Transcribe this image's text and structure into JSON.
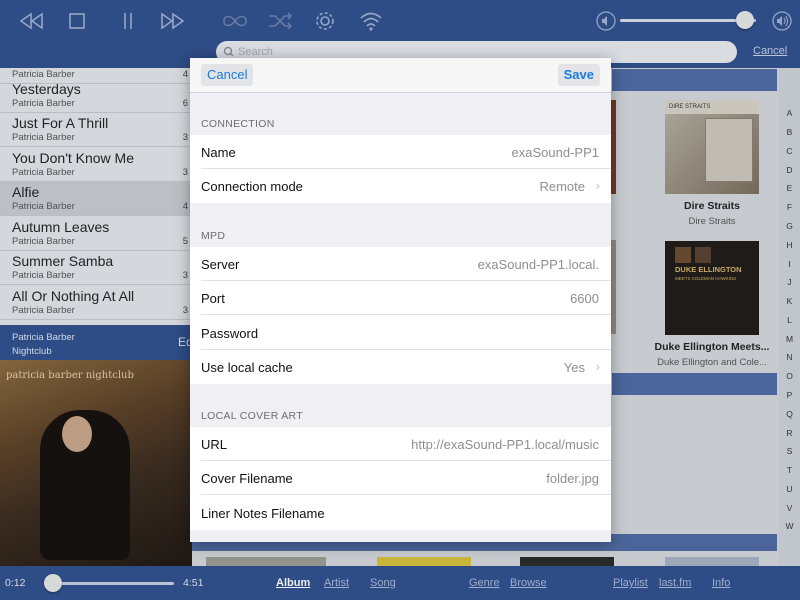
{
  "topbar": {
    "icons": [
      "rewind-icon",
      "stop-icon",
      "pause-icon",
      "fast-forward-icon",
      "repeat-icon",
      "shuffle-icon",
      "gear-icon",
      "wifi-icon",
      "volume-low-icon",
      "volume-high-icon"
    ],
    "volume_level": 0.92,
    "search_placeholder": "Search",
    "search_cancel": "Cancel"
  },
  "songlist": {
    "partial_top_artist": "Patricia Barber",
    "partial_top_number": "4",
    "songs": [
      {
        "title": "Yesterdays",
        "artist": "Patricia Barber",
        "num": "6"
      },
      {
        "title": "Just For A Thrill",
        "artist": "Patricia Barber",
        "num": "3"
      },
      {
        "title": "You Don't Know Me",
        "artist": "Patricia Barber",
        "num": "3"
      },
      {
        "title": "Alfie",
        "artist": "Patricia Barber",
        "num": "4"
      },
      {
        "title": "Autumn Leaves",
        "artist": "Patricia Barber",
        "num": "5"
      },
      {
        "title": "Summer Samba",
        "artist": "Patricia Barber",
        "num": "3"
      },
      {
        "title": "All Or Nothing At All",
        "artist": "Patricia Barber",
        "num": "3"
      }
    ]
  },
  "nowplaying": {
    "artist": "Patricia Barber",
    "album": "Nightclub",
    "edit_partial": "Ed",
    "cover_text": "patricia barber nightclub"
  },
  "albums": [
    {
      "title": "Dire Straits",
      "artist": "Dire Straits"
    },
    {
      "title": "Duke Ellington Meets...",
      "artist": "Duke Ellington and Cole..."
    }
  ],
  "album_art_text": {
    "dire_straits": "DIRE STRAITS",
    "duke_ellington": "DUKE ELLINGTON",
    "duke_sub": "MEETS COLEMAN HAWKINS"
  },
  "index_letters": [
    "A",
    "B",
    "C",
    "D",
    "E",
    "F",
    "G",
    "H",
    "I",
    "J",
    "K",
    "L",
    "M",
    "N",
    "O",
    "P",
    "Q",
    "R",
    "S",
    "T",
    "U",
    "V",
    "W"
  ],
  "player": {
    "elapsed": "0:12",
    "total": "4:51",
    "progress": 0.04
  },
  "bottom_nav": [
    {
      "label": "Album",
      "active": true
    },
    {
      "label": "Artist",
      "active": false
    },
    {
      "label": "Song",
      "active": false
    },
    {
      "label": "Genre",
      "active": false
    },
    {
      "label": "Browse",
      "active": false
    },
    {
      "label": "Playlist",
      "active": false
    },
    {
      "label": "last.fm",
      "active": false
    },
    {
      "label": "Info",
      "active": false
    }
  ],
  "modal": {
    "cancel_label": "Cancel",
    "save_label": "Save",
    "sections": [
      {
        "header": "CONNECTION",
        "rows": [
          {
            "label": "Name",
            "value": "exaSound-PP1",
            "chevron": false
          },
          {
            "label": "Connection mode",
            "value": "Remote",
            "chevron": true
          }
        ]
      },
      {
        "header": "MPD",
        "rows": [
          {
            "label": "Server",
            "value": "exaSound-PP1.local.",
            "chevron": false
          },
          {
            "label": "Port",
            "value": "6600",
            "chevron": false
          },
          {
            "label": "Password",
            "value": "",
            "chevron": false
          },
          {
            "label": "Use local cache",
            "value": "Yes",
            "chevron": true
          }
        ]
      },
      {
        "header": "LOCAL COVER ART",
        "rows": [
          {
            "label": "URL",
            "value": "http://exaSound-PP1.local/music",
            "chevron": false
          },
          {
            "label": "Cover Filename",
            "value": "folder.jpg",
            "chevron": false
          },
          {
            "label": "Liner Notes Filename",
            "value": "",
            "chevron": false
          }
        ]
      }
    ]
  },
  "colors": {
    "bar": "#2f4f8e",
    "accent": "#1a7be0",
    "band": "#4f6aa4"
  }
}
